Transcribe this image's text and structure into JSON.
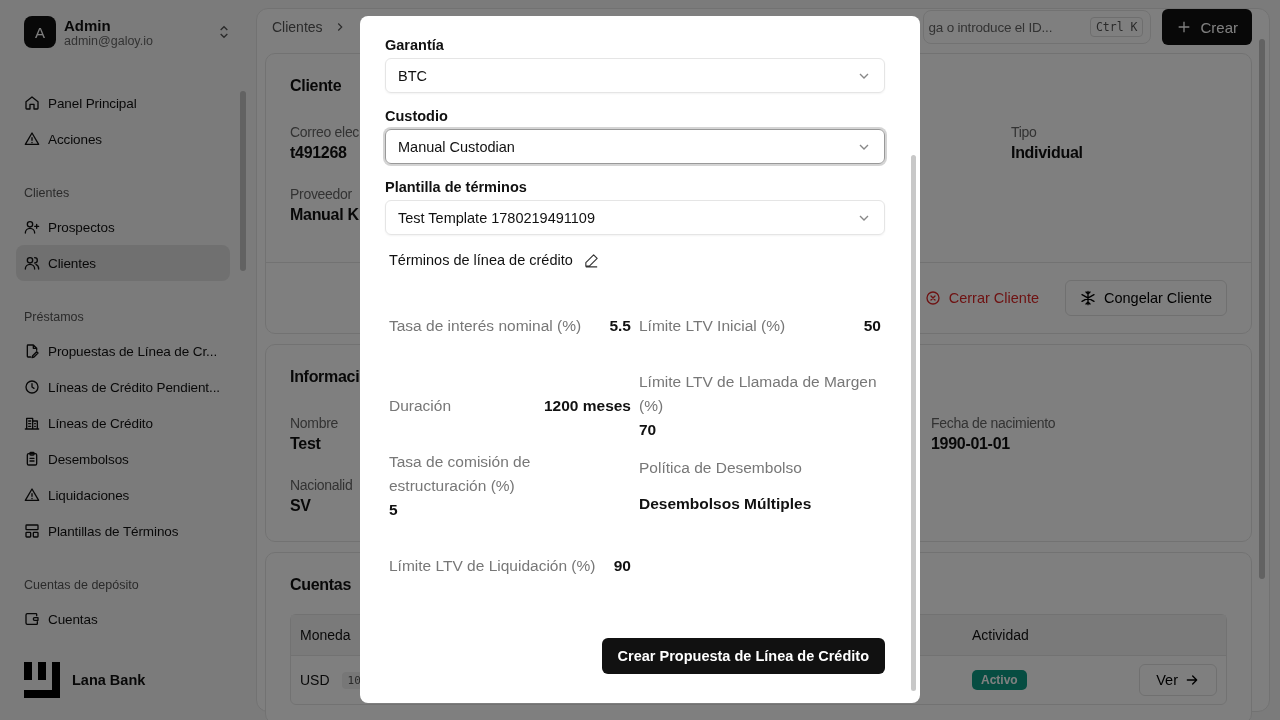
{
  "user": {
    "initial": "A",
    "name": "Admin",
    "email": "admin@galoy.io"
  },
  "nav_sections": [
    {
      "items": [
        {
          "label": "Panel Principal",
          "selected": false
        },
        {
          "label": "Acciones",
          "selected": false
        }
      ]
    },
    {
      "title": "Clientes",
      "items": [
        {
          "label": "Prospectos",
          "selected": false
        },
        {
          "label": "Clientes",
          "selected": true
        }
      ]
    },
    {
      "title": "Préstamos",
      "items": [
        {
          "label": "Propuestas de Línea de Cr...",
          "selected": false
        },
        {
          "label": "Líneas de Crédito Pendient...",
          "selected": false
        },
        {
          "label": "Líneas de Crédito",
          "selected": false
        },
        {
          "label": "Desembolsos",
          "selected": false
        },
        {
          "label": "Liquidaciones",
          "selected": false
        },
        {
          "label": "Plantillas de Términos",
          "selected": false
        }
      ]
    },
    {
      "title": "Cuentas de depósito",
      "items": [
        {
          "label": "Cuentas",
          "selected": false
        }
      ]
    }
  ],
  "brand": "Lana Bank",
  "breadcrumb": [
    "Clientes"
  ],
  "search": {
    "placeholder": "ga o introduce el ID...",
    "shortcut": "Ctrl K"
  },
  "create_button": "Crear",
  "client_card": {
    "title": "Cliente",
    "fields": [
      {
        "label": "Correo elec",
        "value": "t491268"
      },
      {
        "label": "Tipo",
        "value": "Individual"
      },
      {
        "label": "Proveedor",
        "value": "Manual K"
      }
    ],
    "close_action": "Cerrar Cliente",
    "freeze_action": "Congelar Cliente"
  },
  "info_card": {
    "title": "Informaci",
    "fields": [
      {
        "label": "Nombre",
        "value": "Test"
      },
      {
        "label": "Fecha de nacimiento",
        "value": "1990-01-01"
      },
      {
        "label": "Nacionalid",
        "value": "SV"
      }
    ]
  },
  "accounts_card": {
    "title": "Cuentas",
    "columns": [
      "Moneda",
      "Actividad"
    ],
    "rows": [
      {
        "currency": "USD",
        "account": "10",
        "status": "Activo",
        "action": "Ver"
      }
    ]
  },
  "dialog": {
    "selects": [
      {
        "label": "Garantía",
        "value": "BTC",
        "focused": false
      },
      {
        "label": "Custodio",
        "value": "Manual Custodian",
        "focused": true
      },
      {
        "label": "Plantilla de términos",
        "value": "Test Template 1780219491109",
        "focused": false
      }
    ],
    "terms_title": "Términos de línea de crédito",
    "terms": [
      {
        "kind": "inline",
        "label": "Tasa de interés nominal (%)",
        "value": "5.5"
      },
      {
        "kind": "inline",
        "label": "Duración",
        "value": "1200 meses"
      },
      {
        "kind": "stacked",
        "label": "Tasa de comisión de estructuración (%)",
        "value": "5"
      },
      {
        "kind": "inline",
        "label": "Límite LTV de Liquidación (%)",
        "value": "90"
      },
      {
        "kind": "inline",
        "label": "Límite LTV Inicial (%)",
        "value": "50"
      },
      {
        "kind": "stacked",
        "label": "Límite LTV de Llamada de Margen (%)",
        "value": "70"
      },
      {
        "kind": "spaced",
        "label": "Política de Desembolso",
        "value": "Desembolsos Múltiples"
      }
    ],
    "submit": "Crear Propuesta de Línea de Crédito"
  }
}
